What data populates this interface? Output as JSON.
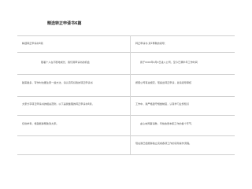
{
  "document": {
    "title": "精选转正申请书6篇",
    "left_column": {
      "heading": "精选转正申请书6篇",
      "lines": [
        "随着个人在不断地成长，我们用申请书的机会",
        "越来越多，写作时也要注意一些方法，请认真写好我的转正申请书",
        "大家分享转正申请书的相关范例，以下是我整理的转正申请书6篇，",
        "仅供参考，希望能够帮助到大家。"
      ]
    },
    "right_column": {
      "heading": "转正申请书 篇1尊敬的领导：",
      "lines": [
        "我于xxxx年x月x日进入公司，至今已满半年工作时间",
        "按照公司有关规定，现提出转正申请，恳请领导审核",
        "工作中，我严格遵守规章制度，认真学习业务知识",
        "虚心向同事请教，尽快熟悉本职工作的各个环节，",
        "现在我已经能够独立完成各项工作的实际操作流程。"
      ]
    }
  }
}
